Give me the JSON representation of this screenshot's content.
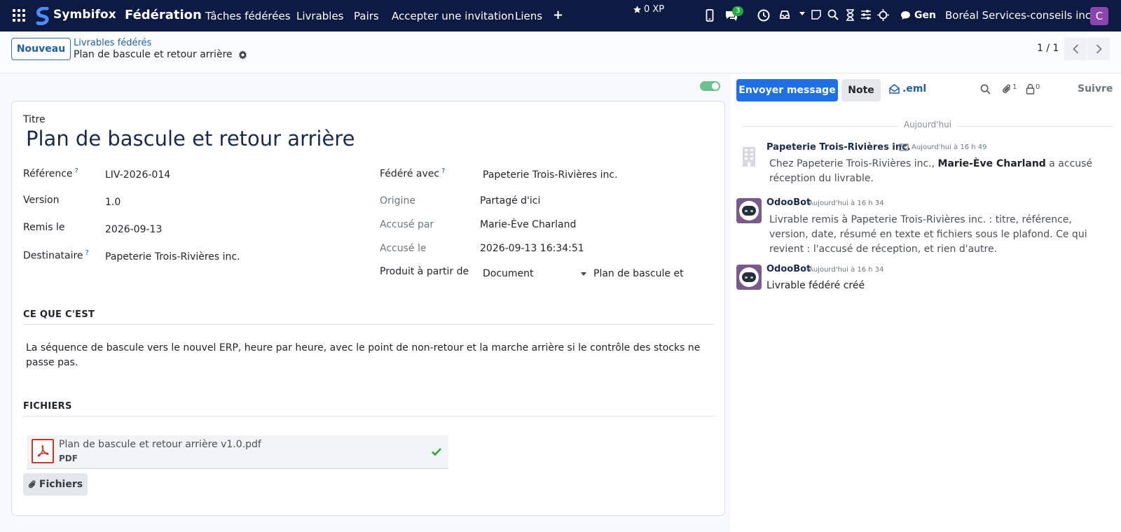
{
  "navbar": {
    "brand": "Symbifox",
    "app_title": "Fédération",
    "menu": [
      "Tâches fédérées",
      "Livrables",
      "Pairs",
      "Accepter une invitation",
      "Liens"
    ],
    "xp": "0 XP",
    "messages_badge": "3",
    "assistant_label": "Gen",
    "company": "Boréal Services-conseils inc.",
    "user_initial": "C"
  },
  "control": {
    "new_button": "Nouveau",
    "breadcrumb_parent": "Livrables fédérés",
    "breadcrumb_current": "Plan de bascule et retour arrière",
    "pager": "1 / 1"
  },
  "form": {
    "title_label": "Titre",
    "title": "Plan de bascule et retour arrière",
    "left_fields": [
      {
        "label": "Référence",
        "help": "?",
        "value": "LIV-2026-014"
      },
      {
        "label": "Version",
        "help": "",
        "value": "1.0"
      },
      {
        "label": "Remis le",
        "help": "",
        "value": "2026-09-13"
      },
      {
        "label": "Destinataire",
        "help": "?",
        "value": "Papeterie Trois-Rivières inc."
      }
    ],
    "right_fields": [
      {
        "label": "Fédéré avec",
        "help": "?",
        "value": "Papeterie Trois-Rivières inc."
      },
      {
        "label": "Origine",
        "help": "",
        "value": "Partagé d'ici"
      },
      {
        "label": "Accusé par",
        "help": "",
        "value": "Marie-Ève Charland"
      },
      {
        "label": "Accusé le",
        "help": "",
        "value": "2026-09-13 16:34:51"
      }
    ],
    "produced_from": {
      "label": "Produit à partir de",
      "model": "Document",
      "record": "Plan de bascule et r"
    },
    "section_what": "CE QUE C'EST",
    "description": "La séquence de bascule vers le nouvel ERP, heure par heure, avec le point de non-retour et la marche arrière si le contrôle des stocks ne passe pas.",
    "section_files": "FICHIERS",
    "file": {
      "name": "Plan de bascule et retour arrière v1.0.pdf",
      "type": "PDF"
    },
    "files_button": "Fichiers",
    "colors": {
      "title": "#1a2a4e",
      "toggle": "#6cc28c"
    }
  },
  "chatter": {
    "send_message": "Envoyer message",
    "note": "Note",
    "eml": ".eml",
    "attachments_count": "1",
    "followers_count": "0",
    "follow": "Suivre",
    "day": "Aujourd'hui",
    "messages": [
      {
        "author": "Papeterie Trois-Rivières inc.",
        "meta": "Aujourd'hui à 16 h 49",
        "prefix": "Chez Papeterie Trois-Rivières inc., ",
        "bold": "Marie-Ève Charland",
        "suffix": " a accusé réception du livrable."
      },
      {
        "author": "OdooBot",
        "meta": "Aujourd'hui à 16 h 34",
        "body": "Livrable remis à Papeterie Trois-Rivières inc. : titre, référence, version, date, résumé en texte et fichiers sous le plafond. Ce qui revient : l'accusé de réception, et rien d'autre."
      },
      {
        "author": "OdooBot",
        "meta": "Aujourd'hui à 16 h 34",
        "body": "Livrable fédéré créé"
      }
    ]
  },
  "colors": {
    "navbar": "#0d1b42",
    "primary": "#1f6fe5",
    "link": "#1f5fa6",
    "avatar": "#8e44ad"
  }
}
